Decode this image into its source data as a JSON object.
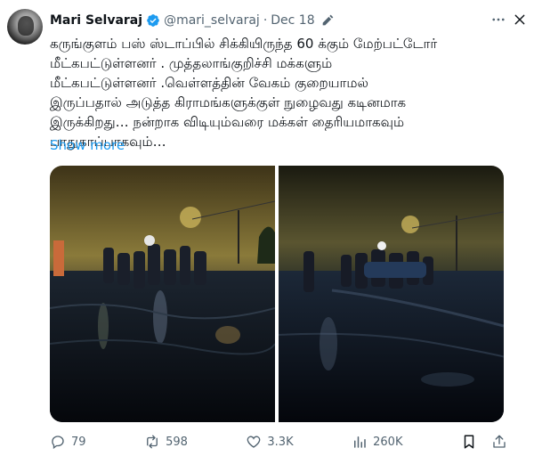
{
  "tweet": {
    "author_name": "Mari Selvaraj",
    "handle": "@mari_selvaraj",
    "separator": "·",
    "date": "Dec 18",
    "lines": [
      "கருங்குளம் பஸ் ஸ்டாப்பில் சிக்கியிருந்த 60 க்கும் மேற்பட்டோர்",
      "மீட்கபட்டுள்ளனர்  . முத்தலாங்குறிச்சி மக்களும்",
      "மீட்கபட்டுள்ளனர் .வெள்ளத்தின் வேகம் குறையாமல்",
      "இருப்பதால் அடுத்த கிராமங்களுக்குள் நுழைவது கடினமாக",
      "இருக்கிறது… நன்றாக விடியும்வரை மக்கள் தைரியமாகவும்",
      "பாதுகாப்பாகவும்…"
    ],
    "show_more": "Show more"
  },
  "icons": {
    "verified": "verified-badge-icon",
    "edit": "edit-pencil-icon",
    "more": "more-dots-icon",
    "close": "close-icon",
    "reply": "reply-icon",
    "retweet": "retweet-icon",
    "like": "heart-icon",
    "views": "views-icon",
    "bookmark": "bookmark-icon",
    "share": "share-icon"
  },
  "metrics": {
    "replies": "79",
    "retweets": "598",
    "likes": "3.3K",
    "views": "260K"
  },
  "colors": {
    "accent": "#1d9bf0",
    "text": "#0f1419",
    "secondary": "#536471"
  }
}
